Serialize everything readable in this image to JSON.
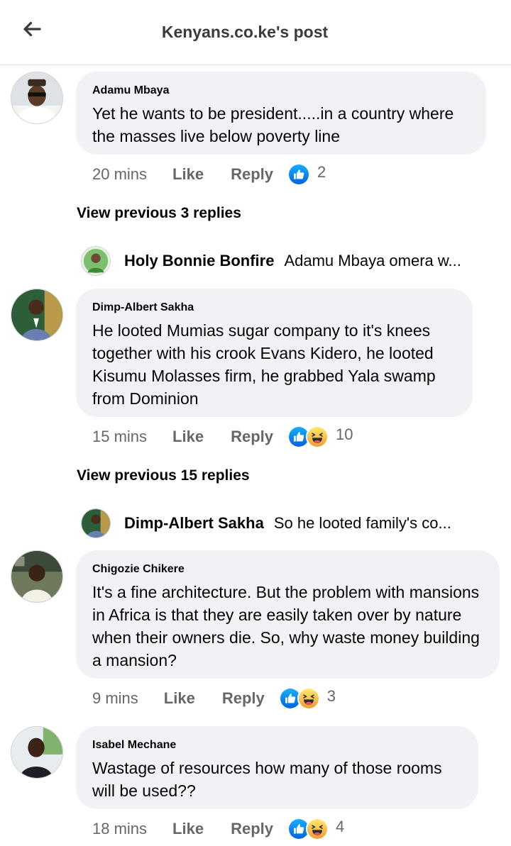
{
  "header": {
    "title": "Kenyans.co.ke's post",
    "back_icon": "arrow-left-icon"
  },
  "comments": [
    {
      "author": "Adamu Mbaya",
      "text": "Yet he wants to be president.....in a country where the masses live below poverty line",
      "time": "20 mins",
      "like": "Like",
      "reply": "Reply",
      "reaction_count": "2",
      "reactions": [
        "like-icon"
      ]
    },
    {
      "author": "Dimp-Albert Sakha",
      "text": "He looted Mumias sugar company to it's knees together with his crook Evans Kidero, he looted Kisumu  Molasses firm, he grabbed Yala swamp from Dominion",
      "time": "15 mins",
      "like": "Like",
      "reply": "Reply",
      "reaction_count": "10",
      "reactions": [
        "like-icon",
        "haha-icon"
      ]
    },
    {
      "author": "Chigozie Chikere",
      "text": "It's a fine architecture. But the problem with mansions in Africa is that they are easily taken over by nature when their owners die. So, why waste money building a mansion?",
      "time": "9 mins",
      "like": "Like",
      "reply": "Reply",
      "reaction_count": "3",
      "reactions": [
        "like-icon",
        "haha-icon"
      ]
    },
    {
      "author": "Isabel Mechane",
      "text": "Wastage of resources how many of those rooms will be used??",
      "time": "18 mins",
      "like": "Like",
      "reply": "Reply",
      "reaction_count": "4",
      "reactions": [
        "like-icon",
        "haha-icon"
      ]
    }
  ],
  "threads": [
    {
      "view_previous": "View previous 3 replies",
      "reply_author": "Holy Bonnie Bonfire",
      "reply_snippet": "Adamu Mbaya omera w..."
    },
    {
      "view_previous": "View previous 15 replies",
      "reply_author": "Dimp-Albert Sakha",
      "reply_snippet": "So he looted family's co..."
    }
  ],
  "colors": {
    "bubble": "#f0f2f5",
    "secondary_text": "#65676b",
    "like_blue": "#1877f2",
    "haha_yellow": "#f7b125"
  }
}
